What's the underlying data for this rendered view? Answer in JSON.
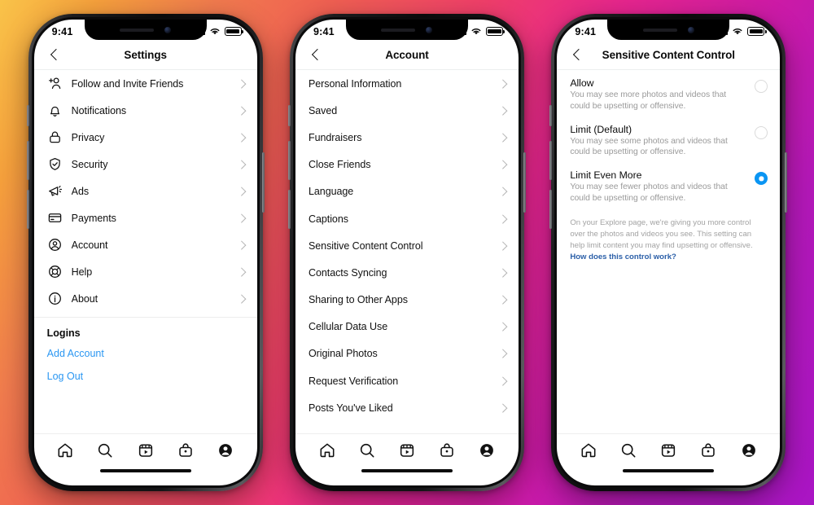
{
  "background": {
    "gradient_colors": [
      "#f9c349",
      "#f07a4e",
      "#ef3e6a",
      "#cc1aa6",
      "#a915c4"
    ]
  },
  "accent": {
    "link_blue": "#2b97f2",
    "radio_blue": "#0a95f3",
    "footnote_link": "#2b5fa8"
  },
  "status_bar": {
    "time": "9:41",
    "signal": "signal-bars",
    "wifi": "wifi",
    "battery": "battery-full"
  },
  "tab_bar": {
    "items": [
      {
        "name": "home",
        "label": "Home"
      },
      {
        "name": "search",
        "label": "Search"
      },
      {
        "name": "reels",
        "label": "Reels"
      },
      {
        "name": "shop",
        "label": "Shop"
      },
      {
        "name": "profile",
        "label": "Profile"
      }
    ]
  },
  "phones": [
    {
      "id": "settings",
      "nav": {
        "back": "back-chevron",
        "title": "Settings"
      },
      "rows": [
        {
          "icon": "person-add-icon",
          "label": "Follow and Invite Friends"
        },
        {
          "icon": "bell-icon",
          "label": "Notifications"
        },
        {
          "icon": "lock-icon",
          "label": "Privacy"
        },
        {
          "icon": "shield-check-icon",
          "label": "Security"
        },
        {
          "icon": "megaphone-icon",
          "label": "Ads"
        },
        {
          "icon": "credit-card-icon",
          "label": "Payments"
        },
        {
          "icon": "account-circle-icon",
          "label": "Account"
        },
        {
          "icon": "life-ring-icon",
          "label": "Help"
        },
        {
          "icon": "info-circle-icon",
          "label": "About"
        }
      ],
      "section": {
        "title": "Logins"
      },
      "links": [
        {
          "label": "Add Account"
        },
        {
          "label": "Log Out"
        }
      ]
    },
    {
      "id": "account",
      "nav": {
        "back": "back-chevron",
        "title": "Account"
      },
      "rows": [
        {
          "label": "Personal Information"
        },
        {
          "label": "Saved"
        },
        {
          "label": "Fundraisers"
        },
        {
          "label": "Close Friends"
        },
        {
          "label": "Language"
        },
        {
          "label": "Captions"
        },
        {
          "label": "Sensitive Content Control"
        },
        {
          "label": "Contacts Syncing"
        },
        {
          "label": "Sharing to Other Apps"
        },
        {
          "label": "Cellular Data Use"
        },
        {
          "label": "Original Photos"
        },
        {
          "label": "Request Verification"
        },
        {
          "label": "Posts You've Liked"
        }
      ]
    },
    {
      "id": "sensitive-content-control",
      "nav": {
        "back": "back-chevron",
        "title": "Sensitive Content Control"
      },
      "options": [
        {
          "title": "Allow",
          "desc": "You may see more photos and videos that could be upsetting or offensive.",
          "selected": false
        },
        {
          "title": "Limit (Default)",
          "desc": "You may see some photos and videos that could be upsetting or offensive.",
          "selected": false
        },
        {
          "title": "Limit Even More",
          "desc": "You may see fewer photos and videos that could be upsetting or offensive.",
          "selected": true
        }
      ],
      "footnote": {
        "text": "On your Explore page, we're giving you more control over the photos and videos you see. This setting can help limit content you may find upsetting or offensive. ",
        "link": "How does this control work?"
      }
    }
  ]
}
